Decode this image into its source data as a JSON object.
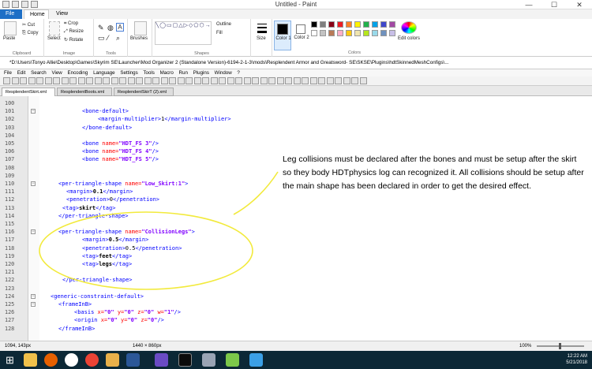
{
  "paint": {
    "title": "Untitled - Paint",
    "tabs": [
      "File",
      "Home",
      "View"
    ],
    "clipboard": {
      "paste": "Paste",
      "cut": "Cut",
      "copy": "Copy",
      "label": "Clipboard"
    },
    "image": {
      "select": "Select",
      "crop": "Crop",
      "resize": "Resize",
      "rotate": "Rotate",
      "label": "Image"
    },
    "tools_label": "Tools",
    "brushes": "Brushes",
    "shapes": {
      "outline": "Outline",
      "fill": "Fill",
      "label": "Shapes"
    },
    "size": "Size",
    "color1": "Color 1",
    "color2": "Color 2",
    "colors_label": "Colors",
    "edit_colors": "Edit colors",
    "palette": [
      "#000000",
      "#7f7f7f",
      "#880015",
      "#ed1c24",
      "#ff7f27",
      "#fff200",
      "#22b14c",
      "#00a2e8",
      "#3f48cc",
      "#a349a4",
      "#ffffff",
      "#c3c3c3",
      "#b97a57",
      "#ffaec9",
      "#ffc90e",
      "#efe4b0",
      "#b5e61d",
      "#99d9ea",
      "#7092be",
      "#c8bfe7"
    ],
    "status": {
      "pos": "1094, 143px",
      "dims": "1440 × 860px",
      "zoom": "100%"
    }
  },
  "notepad": {
    "title": "*D:\\Users\\Tonyo Allie\\Desktop\\Games\\Skyrim SE\\Launcher\\Mod Organizer 2 (Standalone Version)-6194-2-1-3\\mods\\Resplendent Armor and Greatsword- SE\\SKSE\\Plugins\\hdtSkinnedMeshConfigs\\...",
    "menu": [
      "File",
      "Edit",
      "Search",
      "View",
      "Encoding",
      "Language",
      "Settings",
      "Tools",
      "Macro",
      "Run",
      "Plugins",
      "Window",
      "?"
    ],
    "tabs": [
      "ResplendentSkirt.xml",
      "ResplendentBoots.xml",
      "ResplendentSkirT (2).xml"
    ]
  },
  "code": [
    {
      "n": "100",
      "t": ""
    },
    {
      "n": "101",
      "t": "bone-default-open"
    },
    {
      "n": "102",
      "t": "margin-mult"
    },
    {
      "n": "103",
      "t": "bone-default-close"
    },
    {
      "n": "104",
      "t": ""
    },
    {
      "n": "105",
      "t": "bone3"
    },
    {
      "n": "106",
      "t": "bone4"
    },
    {
      "n": "107",
      "t": "bone5"
    },
    {
      "n": "108",
      "t": ""
    },
    {
      "n": "109",
      "t": ""
    },
    {
      "n": "110",
      "t": "pts1"
    },
    {
      "n": "111",
      "t": "margin1"
    },
    {
      "n": "112",
      "t": "pen1"
    },
    {
      "n": "113",
      "t": "tag-skirt"
    },
    {
      "n": "114",
      "t": "pts-close"
    },
    {
      "n": "115",
      "t": ""
    },
    {
      "n": "116",
      "t": "pts2"
    },
    {
      "n": "117",
      "t": "margin2"
    },
    {
      "n": "118",
      "t": "pen2"
    },
    {
      "n": "119",
      "t": "tag-feet"
    },
    {
      "n": "120",
      "t": "tag-legs"
    },
    {
      "n": "121",
      "t": ""
    },
    {
      "n": "122",
      "t": "pts2-close"
    },
    {
      "n": "123",
      "t": ""
    },
    {
      "n": "124",
      "t": "gcd"
    },
    {
      "n": "125",
      "t": "frameinb"
    },
    {
      "n": "126",
      "t": "basis"
    },
    {
      "n": "127",
      "t": "origin"
    },
    {
      "n": "128",
      "t": "frameinb-close"
    }
  ],
  "tokens": {
    "bone_default_open": "<bone-default>",
    "margin_mult_open": "<margin-multiplier>",
    "margin_mult_val": "1",
    "margin_mult_close": "</margin-multiplier>",
    "bone_default_close": "</bone-default>",
    "bone_open": "<bone ",
    "name_attr": "name=",
    "bone3": "\"HDT_FS 3\"",
    "bone4": "\"HDT_FS 4\"",
    "bone5": "\"HDT_FS 5\"",
    "bone_close": "/>",
    "pts_open": "<per-triangle-shape ",
    "pts1_name": "\"Low_Skirt:1\"",
    "pts_gt": ">",
    "margin_open": "<margin>",
    "margin1": "0.1",
    "margin_close": "</margin>",
    "pen_open": "<penetration>",
    "pen1": "0",
    "pen_close": "</penetration>",
    "tag_open": "<tag>",
    "tag_skirt": "skirt",
    "tag_close": "</tag>",
    "pts_close": "</per-triangle-shape>",
    "pts2_name": "\"CollisionLegs\"",
    "margin2": "0.5",
    "pen2": "0.5",
    "tag_feet": "feet",
    "tag_legs": "legs",
    "gcd": "<generic-constraint-default>",
    "frameinb": "<frameInB>",
    "basis_open": "<basis ",
    "x_attr": "x=",
    "y_attr": "y=",
    "z_attr": "z=",
    "w_attr": "w=",
    "zero": "\"0\"",
    "one": "\"1\"",
    "origin_open": "<origin ",
    "frameinb_close": "</frameInB>"
  },
  "note": "Leg collisions must be declared after the bones and must be setup after the skirt so they body HDTphysics log can recognized it. All collisions should be setup after the main shape has been declared in order to get the desired effect.",
  "taskbar": {
    "time": "12:22 AM",
    "date": "5/21/2018"
  }
}
